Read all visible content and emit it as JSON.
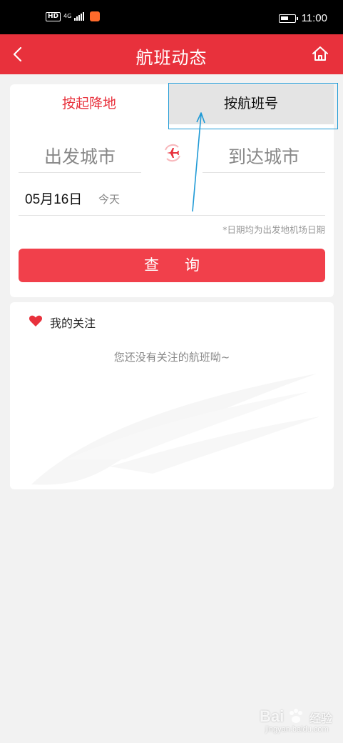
{
  "status_bar": {
    "hd_badge": "HD",
    "network": "4G",
    "time": "11:00"
  },
  "nav": {
    "title": "航班动态",
    "back_icon": "chevron-left-icon",
    "home_icon": "home-icon"
  },
  "search": {
    "tabs": [
      {
        "label": "按起降地",
        "active": true
      },
      {
        "label": "按航班号",
        "active": false
      }
    ],
    "departure_placeholder": "出发城市",
    "arrival_placeholder": "到达城市",
    "swap_icon": "plane-swap-icon",
    "date": "05月16日",
    "day_label": "今天",
    "date_note": "*日期均为出发地机场日期",
    "search_button": "查询"
  },
  "follow": {
    "title": "我的关注",
    "empty_text": "您还没有关注的航班呦~",
    "heart_icon": "heart-icon"
  },
  "watermark": {
    "brand": "Bai",
    "suffix": "经验",
    "url": "jingyan.baidu.com"
  },
  "colors": {
    "primary": "#e8313c",
    "button": "#f1404b",
    "highlight_box": "#1f9ad6",
    "background": "#f2f2f2"
  }
}
